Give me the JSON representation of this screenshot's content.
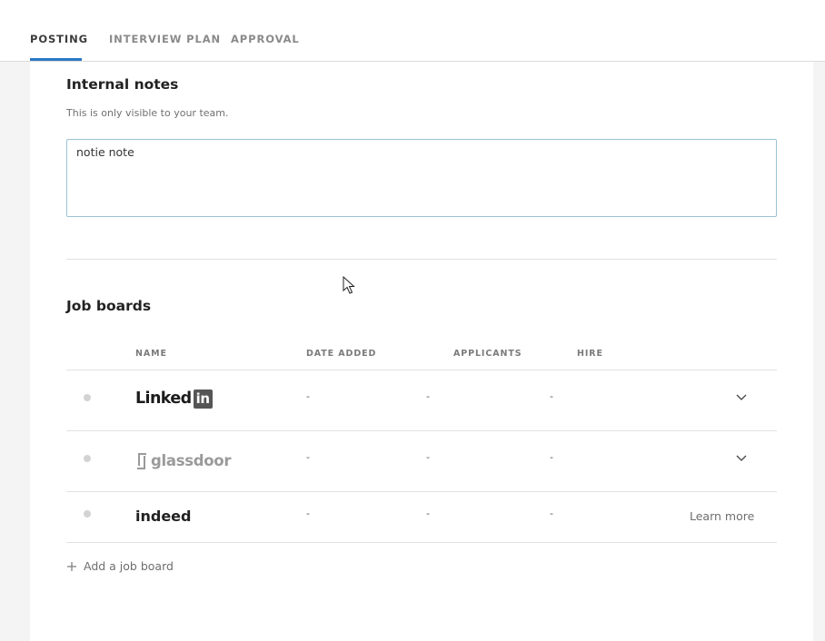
{
  "tabs": [
    {
      "label": "POSTING",
      "active": true
    },
    {
      "label": "INTERVIEW PLAN",
      "active": false
    },
    {
      "label": "APPROVAL",
      "active": false
    }
  ],
  "internal_notes": {
    "title": "Internal notes",
    "helper": "This is only visible to your team.",
    "value": "notie note"
  },
  "job_boards": {
    "title": "Job boards",
    "columns": [
      "NAME",
      "DATE ADDED",
      "APPLICANTS",
      "HIRE"
    ],
    "rows": [
      {
        "name": "LinkedIn",
        "logo_text": "Linked",
        "logo_badge": "in",
        "date_added": "-",
        "applicants": "-",
        "hire": "-",
        "action": "chevron-down-icon"
      },
      {
        "name": "glassdoor",
        "logo_text": "glassdoor",
        "date_added": "-",
        "applicants": "-",
        "hire": "-",
        "action": "chevron-down-icon"
      },
      {
        "name": "indeed",
        "logo_text": "indeed",
        "date_added": "-",
        "applicants": "-",
        "hire": "-",
        "action_label": "Learn more"
      }
    ],
    "add_label": "Add a job board"
  },
  "colors": {
    "accent": "#2a78c7",
    "textbox_border": "#9cc3d6",
    "background": "#f4f4f4"
  }
}
